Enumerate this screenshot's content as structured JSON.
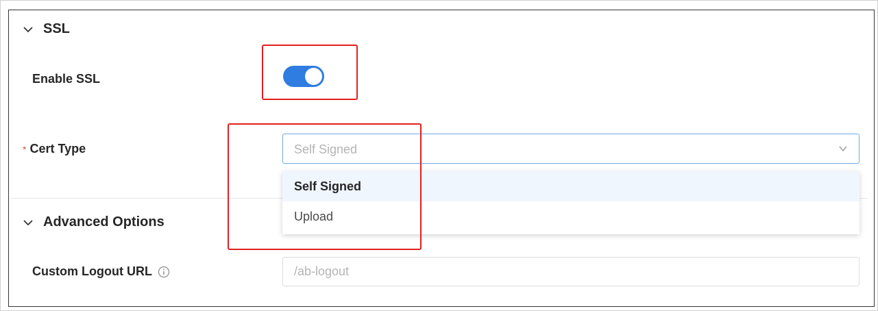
{
  "ssl_section": {
    "title": "SSL",
    "enable_ssl_label": "Enable SSL",
    "enable_ssl_on": true,
    "cert_type_label": "Cert Type",
    "required_marker": "*",
    "cert_type_value": "Self Signed",
    "cert_type_options": [
      "Self Signed",
      "Upload"
    ]
  },
  "advanced_section": {
    "title": "Advanced Options",
    "custom_logout_label": "Custom Logout URL",
    "custom_logout_placeholder": "/ab-logout"
  },
  "colors": {
    "toggle_on": "#2f7de1",
    "highlight": "#e31e1e",
    "required": "#e34d4d"
  },
  "icons": {
    "section_toggle": "chevron-down-icon",
    "select_caret": "chevron-down-icon",
    "help": "info-circle-icon"
  }
}
